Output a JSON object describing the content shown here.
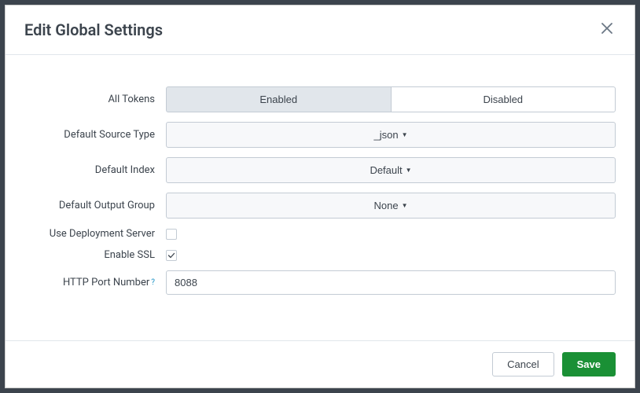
{
  "modal": {
    "title": "Edit Global Settings"
  },
  "form": {
    "all_tokens": {
      "label": "All Tokens",
      "enabled_label": "Enabled",
      "disabled_label": "Disabled",
      "value": "enabled"
    },
    "default_source_type": {
      "label": "Default Source Type",
      "value": "_json"
    },
    "default_index": {
      "label": "Default Index",
      "value": "Default"
    },
    "default_output_group": {
      "label": "Default Output Group",
      "value": "None"
    },
    "use_deployment_server": {
      "label": "Use Deployment Server",
      "checked": false
    },
    "enable_ssl": {
      "label": "Enable SSL",
      "checked": true
    },
    "http_port": {
      "label": "HTTP Port Number",
      "value": "8088"
    }
  },
  "footer": {
    "cancel": "Cancel",
    "save": "Save"
  }
}
